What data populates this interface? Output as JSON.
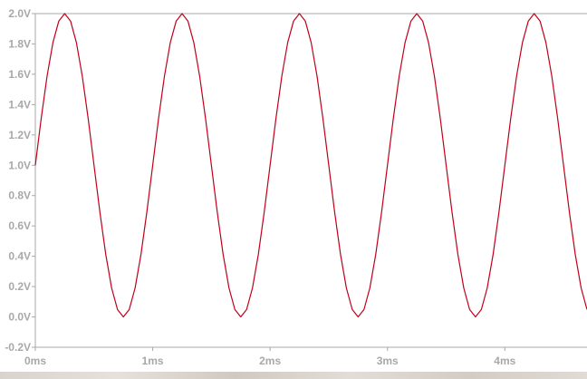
{
  "chart_data": {
    "type": "line",
    "title": "",
    "xlabel": "",
    "ylabel": "",
    "xlim": [
      0,
      4.7
    ],
    "ylim": [
      -0.2,
      2.0
    ],
    "x_ticks": [
      0,
      1,
      2,
      3,
      4
    ],
    "x_tick_labels": [
      "0ms",
      "1ms",
      "2ms",
      "3ms",
      "4ms"
    ],
    "y_ticks": [
      -0.2,
      0.0,
      0.2,
      0.4,
      0.6,
      0.8,
      1.0,
      1.2,
      1.4,
      1.6,
      1.8,
      2.0
    ],
    "y_tick_labels": [
      "-0.2V",
      "0.0V",
      "0.2V",
      "0.4V",
      "0.6V",
      "0.8V",
      "1.0V",
      "1.2V",
      "1.4V",
      "1.6V",
      "1.8V",
      "2.0V"
    ],
    "grid": false,
    "series": [
      {
        "color": "#c0001a",
        "x": [
          0,
          0.05,
          0.1,
          0.15,
          0.2,
          0.25,
          0.3,
          0.35,
          0.4,
          0.45,
          0.5,
          0.55,
          0.6,
          0.65,
          0.7,
          0.75,
          0.8,
          0.85,
          0.9,
          0.95,
          1.0,
          1.05,
          1.1,
          1.15,
          1.2,
          1.25,
          1.3,
          1.35,
          1.4,
          1.45,
          1.5,
          1.55,
          1.6,
          1.65,
          1.7,
          1.75,
          1.8,
          1.85,
          1.9,
          1.95,
          2.0,
          2.05,
          2.1,
          2.15,
          2.2,
          2.25,
          2.3,
          2.35,
          2.4,
          2.45,
          2.5,
          2.55,
          2.6,
          2.65,
          2.7,
          2.75,
          2.8,
          2.85,
          2.9,
          2.95,
          3.0,
          3.05,
          3.1,
          3.15,
          3.2,
          3.25,
          3.3,
          3.35,
          3.4,
          3.45,
          3.5,
          3.55,
          3.6,
          3.65,
          3.7,
          3.75,
          3.8,
          3.85,
          3.9,
          3.95,
          4.0,
          4.05,
          4.1,
          4.15,
          4.2,
          4.25,
          4.3,
          4.35,
          4.4,
          4.45,
          4.5,
          4.55,
          4.6,
          4.65,
          4.7
        ],
        "y": [
          1.0,
          1.309,
          1.588,
          1.809,
          1.951,
          2.0,
          1.951,
          1.809,
          1.588,
          1.309,
          1.0,
          0.691,
          0.412,
          0.191,
          0.049,
          0.0,
          0.049,
          0.191,
          0.412,
          0.691,
          1.0,
          1.309,
          1.588,
          1.809,
          1.951,
          2.0,
          1.951,
          1.809,
          1.588,
          1.309,
          1.0,
          0.691,
          0.412,
          0.191,
          0.049,
          0.0,
          0.049,
          0.191,
          0.412,
          0.691,
          1.0,
          1.309,
          1.588,
          1.809,
          1.951,
          2.0,
          1.951,
          1.809,
          1.588,
          1.309,
          1.0,
          0.691,
          0.412,
          0.191,
          0.049,
          0.0,
          0.049,
          0.191,
          0.412,
          0.691,
          1.0,
          1.309,
          1.588,
          1.809,
          1.951,
          2.0,
          1.951,
          1.809,
          1.588,
          1.309,
          1.0,
          0.691,
          0.412,
          0.191,
          0.049,
          0.0,
          0.049,
          0.191,
          0.412,
          0.691,
          1.0,
          1.309,
          1.588,
          1.809,
          1.951,
          2.0,
          1.951,
          1.809,
          1.588,
          1.309,
          1.0,
          0.691,
          0.412,
          0.191,
          0.049
        ]
      }
    ]
  },
  "colors": {
    "axis": "#a8a8a8",
    "tick_label": "#a8a8a8",
    "background": "#ffffff",
    "trace": "#c0001a"
  }
}
